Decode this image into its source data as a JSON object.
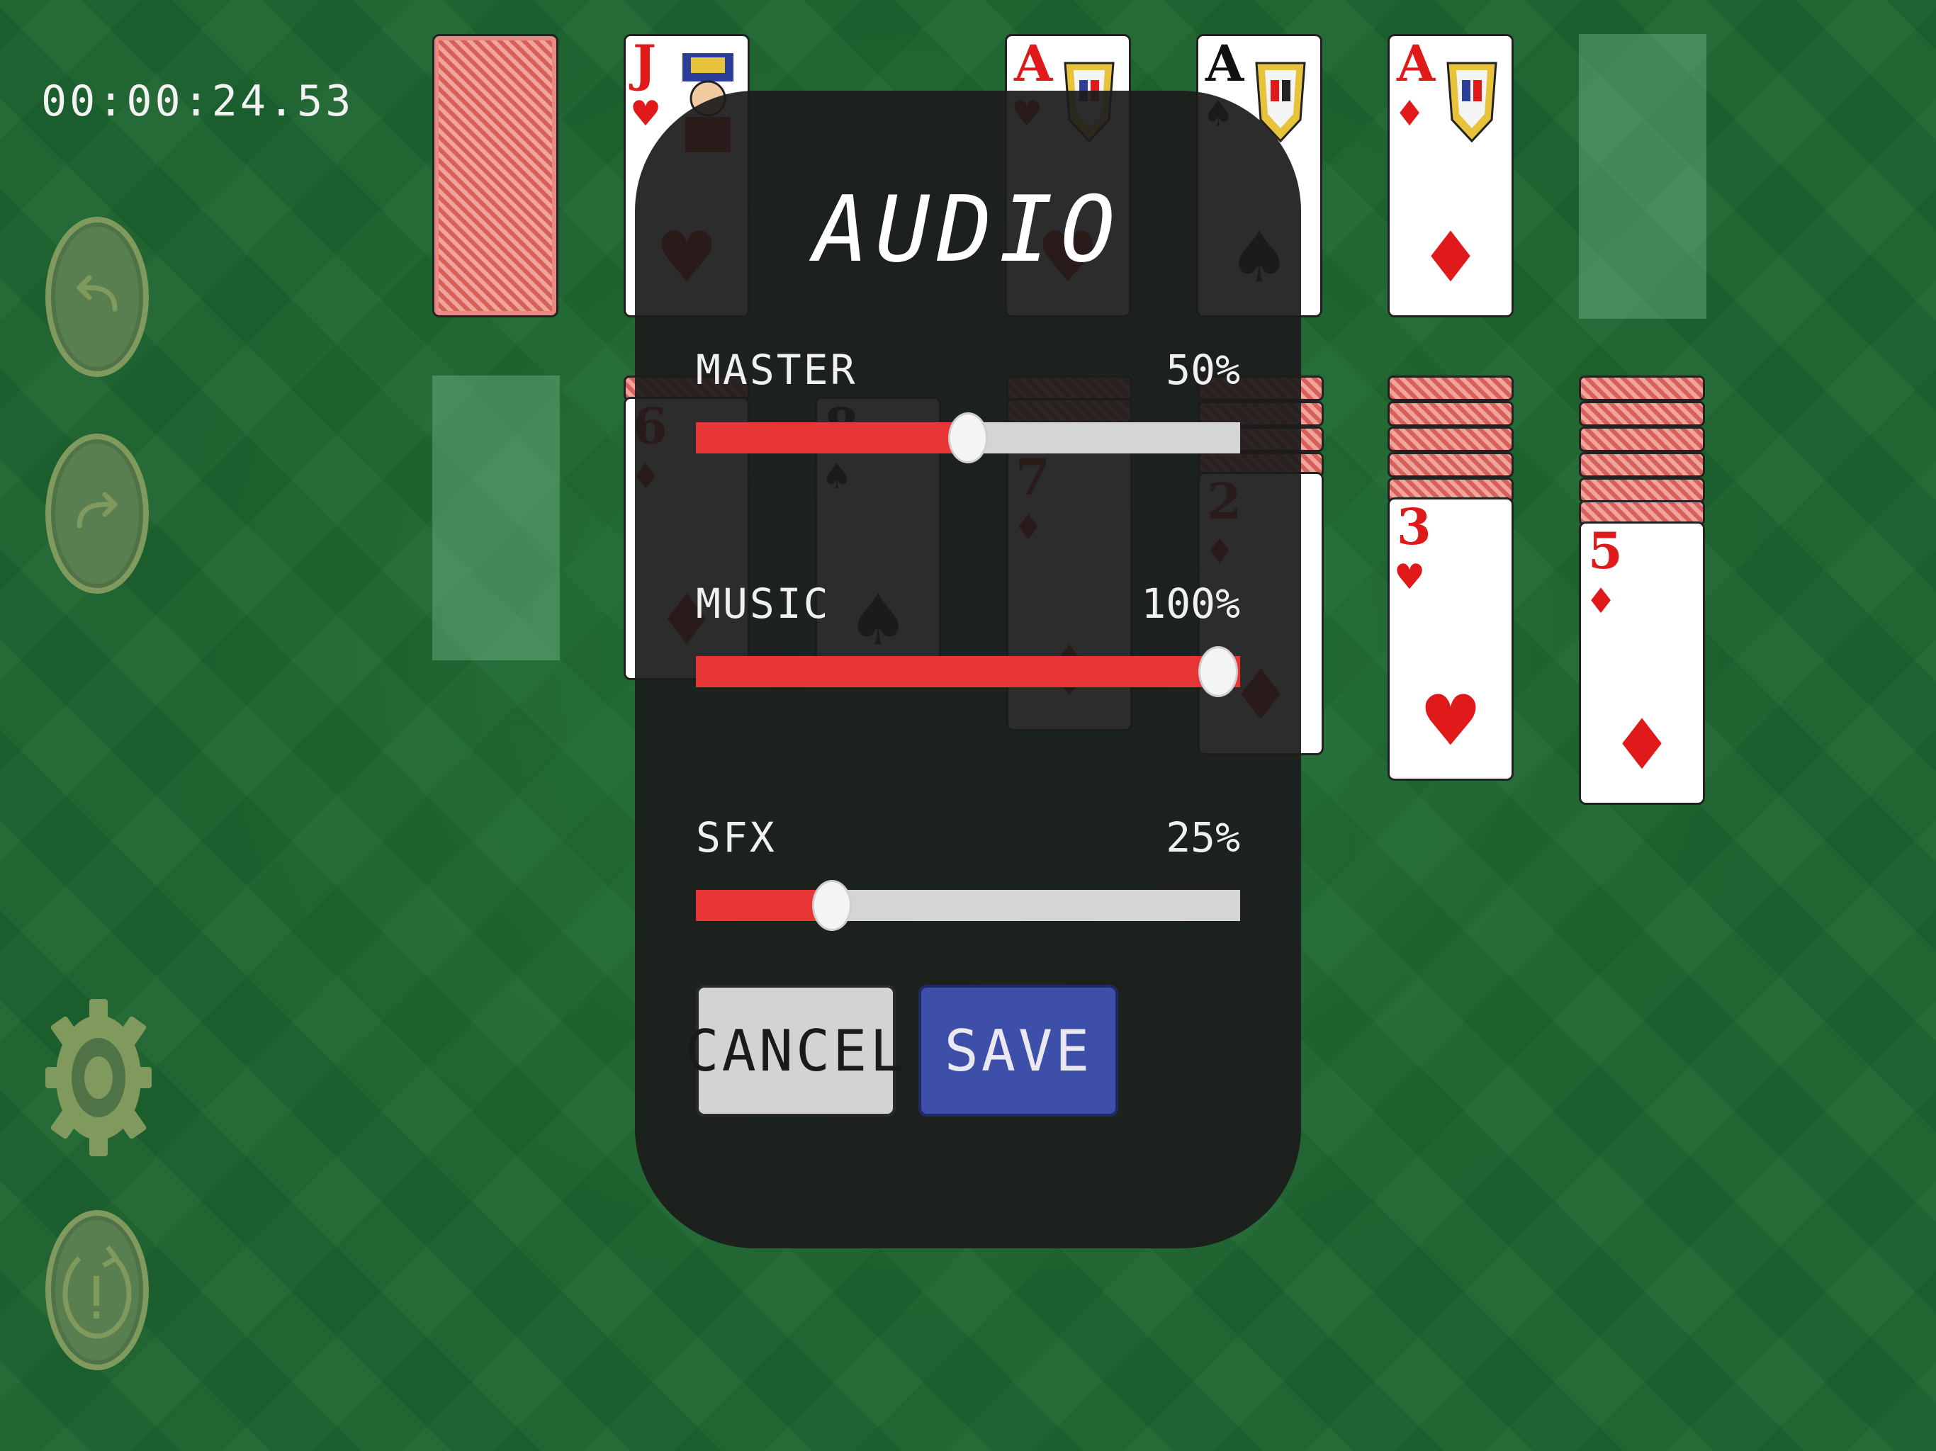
{
  "timer": "00:00:24.53",
  "dialog": {
    "title": "AUDIO",
    "master": {
      "label": "MASTER",
      "value_text": "50%",
      "value": 0.5
    },
    "music": {
      "label": "MUSIC",
      "value_text": "100%",
      "value": 1.0
    },
    "sfx": {
      "label": "SFX",
      "value_text": "25%",
      "value": 0.25
    },
    "cancel_label": "CANCEL",
    "save_label": "SAVE"
  },
  "cards": {
    "foundation_1": {
      "rank": "J",
      "suit": "♥"
    },
    "foundation_2": {
      "rank": "A",
      "suit": "♥"
    },
    "foundation_3": {
      "rank": "A",
      "suit": "♠"
    },
    "foundation_4": {
      "rank": "A",
      "suit": "♦"
    },
    "tableau_1": {
      "rank": "6",
      "suit": "♦"
    },
    "tableau_2": {
      "rank": "8",
      "suit": "♠"
    },
    "tableau_3": {
      "rank": "7",
      "suit": "♦"
    },
    "tableau_4": {
      "rank": "2",
      "suit": "♦"
    },
    "tableau_5": {
      "rank": "3",
      "suit": "♥"
    },
    "tableau_6": {
      "rank": "5",
      "suit": "♦"
    }
  },
  "icons": {
    "undo": "undo-arrow-icon",
    "redo": "redo-arrow-icon",
    "settings": "gear-icon",
    "restart": "restart-icon"
  },
  "colors": {
    "felt": "#1d632f",
    "dialog_bg": "#1c1c1c",
    "slider_fill": "#e83535",
    "slider_track": "#d5d5d5",
    "save_button": "#3d4fa8",
    "cancel_button": "#d3d3d3"
  }
}
